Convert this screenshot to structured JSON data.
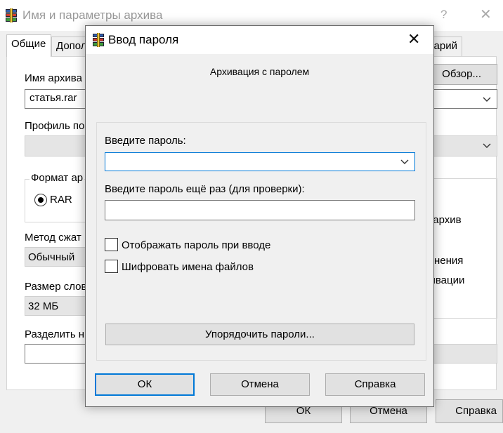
{
  "background_window": {
    "title": "Имя и параметры архива",
    "help_glyph": "?",
    "close_glyph": "✕",
    "tabs": [
      "Общие",
      "Допол",
      "арий"
    ],
    "archive_name_label": "Имя архива",
    "browse_button": "Обзор...",
    "archive_name_value": "статья.rar",
    "profile_label": "Профиль по",
    "format_group_label": "Формат ар",
    "format_rar_label": "RAR",
    "method_label": "Метод сжат",
    "method_value": "Обычный",
    "dict_size_label": "Размер слов",
    "dict_size_value": "32 МБ",
    "split_label": "Разделить н",
    "option_fragments": [
      "я архив",
      "нения",
      "хивации"
    ],
    "ok_button": "ОК",
    "cancel_button": "Отмена",
    "help_button": "Справка"
  },
  "dialog": {
    "title": "Ввод пароля",
    "close_glyph": "✕",
    "heading": "Архивация с паролем",
    "password_label": "Введите пароль:",
    "password_value": "",
    "confirm_label": "Введите пароль ещё раз (для проверки):",
    "confirm_value": "",
    "show_password_label": "Отображать пароль при вводе",
    "show_password_checked": false,
    "encrypt_names_label": "Шифровать имена файлов",
    "encrypt_names_checked": false,
    "organize_button": "Упорядочить пароли...",
    "ok_button": "ОК",
    "cancel_button": "Отмена",
    "help_button": "Справка"
  },
  "colors": {
    "focus_border": "#0078d7",
    "button_face": "#e1e1e1",
    "dialog_face": "#f0f0f0"
  }
}
